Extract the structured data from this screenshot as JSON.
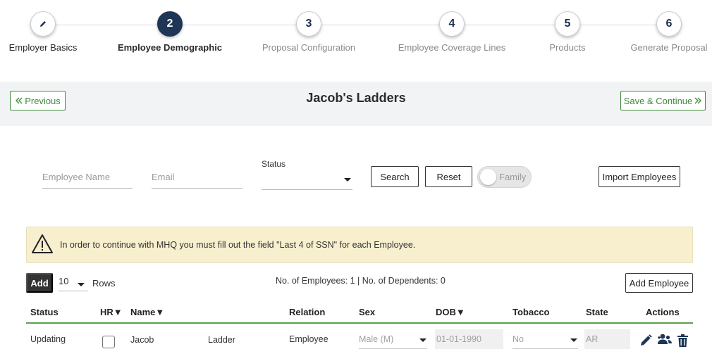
{
  "stepper": {
    "steps": [
      {
        "number": "",
        "label": "Employer Basics"
      },
      {
        "number": "2",
        "label": "Employee Demographic"
      },
      {
        "number": "3",
        "label": "Proposal Configuration"
      },
      {
        "number": "4",
        "label": "Employee Coverage Lines"
      },
      {
        "number": "5",
        "label": "Products"
      },
      {
        "number": "6",
        "label": "Generate Proposal"
      }
    ]
  },
  "header": {
    "title": "Jacob's Ladders",
    "previous_label": "Previous",
    "save_label": "Save & Continue"
  },
  "filters": {
    "employee_name_placeholder": "Employee Name",
    "email_placeholder": "Email",
    "status_label": "Status",
    "search_label": "Search",
    "reset_label": "Reset",
    "family_label": "Family",
    "import_label": "Import Employees"
  },
  "alert": {
    "message": "In order to continue with MHQ you must fill out the field \"Last 4 of SSN\" for each Employee."
  },
  "table_controls": {
    "add_label": "Add",
    "rows_value": "10",
    "rows_label": "Rows",
    "counts": "No. of Employees: 1 | No. of Dependents: 0",
    "add_employee_label": "Add Employee"
  },
  "table": {
    "headers": {
      "status": "Status",
      "hr": "HR▼",
      "name": "Name▼",
      "relation": "Relation",
      "sex": "Sex",
      "dob": "DOB▼",
      "tobacco": "Tobacco",
      "state": "State",
      "actions": "Actions"
    },
    "rows": [
      {
        "status": "Updating",
        "first_name": "Jacob",
        "last_name": "Ladder",
        "relation": "Employee",
        "sex": "Male (M)",
        "dob": "01-01-1990",
        "tobacco": "No",
        "state": "AR"
      }
    ]
  },
  "colors": {
    "accent_green": "#3f8a3a",
    "active_step": "#1f3556",
    "alert_bg": "#f8efcf",
    "icon_blue": "#1f3556"
  }
}
